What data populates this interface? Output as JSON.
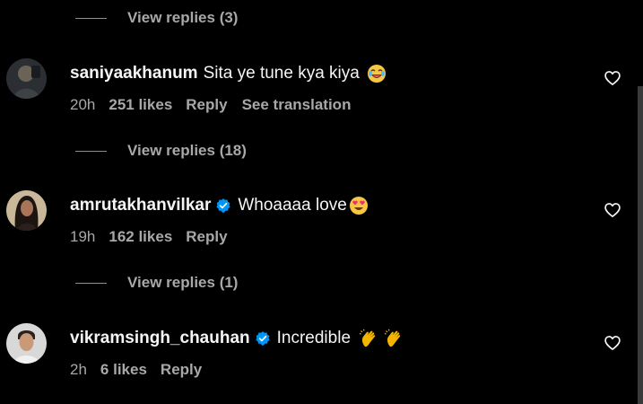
{
  "thread": {
    "view_replies_top": "View replies (3)"
  },
  "comments": [
    {
      "username": "saniyaakhanum",
      "verified": false,
      "text": "Sita ye tune kya kiya",
      "emoji": "laughing-face-emoji",
      "time": "20h",
      "likes": "251 likes",
      "reply": "Reply",
      "translation": "See translation",
      "view_replies": "View replies (18)"
    },
    {
      "username": "amrutakhanvilkar",
      "verified": true,
      "text": "Whoaaaa love",
      "emoji": "heart-eyes-emoji",
      "time": "19h",
      "likes": "162 likes",
      "reply": "Reply",
      "view_replies": "View replies (1)"
    },
    {
      "username": "vikramsingh_chauhan",
      "verified": true,
      "text": "Incredible",
      "emoji": "clapping-hands-emoji",
      "time": "2h",
      "likes": "6 likes",
      "reply": "Reply"
    }
  ],
  "colors": {
    "background": "#000000",
    "primary_text": "#f5f5f5",
    "secondary_text": "#a8a8a8",
    "verified_badge": "#0095f6"
  },
  "icons": {
    "like": "heart-outline-icon",
    "verified": "verified-badge-icon"
  }
}
